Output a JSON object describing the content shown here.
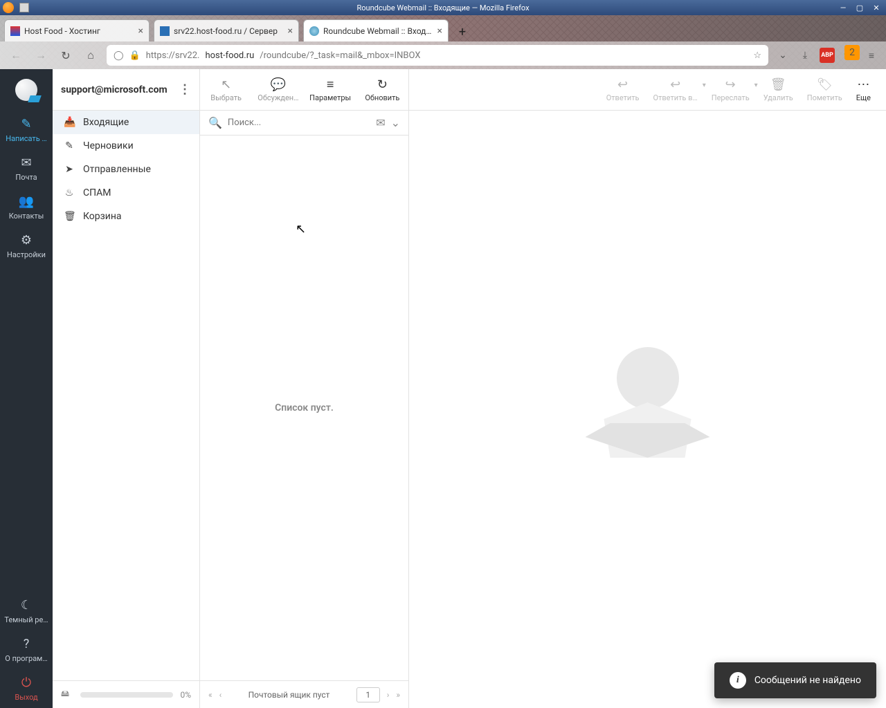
{
  "window": {
    "title": "Roundcube Webmail :: Входящие — Mozilla Firefox"
  },
  "browser": {
    "tabs": [
      {
        "label": "Host Food - Хостинг",
        "active": false
      },
      {
        "label": "srv22.host-food.ru / Сервер",
        "active": false
      },
      {
        "label": "Roundcube Webmail :: Вход…",
        "active": true
      }
    ],
    "url_prefix": "https://srv22.",
    "url_host": "host-food.ru",
    "url_path": "/roundcube/?_task=mail&_mbox=INBOX",
    "puzzle_badge": "2"
  },
  "sidebar": {
    "items": [
      {
        "icon": "✎",
        "label": "Написать …"
      },
      {
        "icon": "✉",
        "label": "Почта"
      },
      {
        "icon": "👥",
        "label": "Контакты"
      },
      {
        "icon": "⚙",
        "label": "Настройки"
      }
    ],
    "bottom": [
      {
        "icon": "☾",
        "label": "Темный ре…"
      },
      {
        "icon": "?",
        "label": "О програм…"
      },
      {
        "icon": "⏻",
        "label": "Выход"
      }
    ]
  },
  "account": {
    "email": "support@microsoft.com"
  },
  "folders": [
    {
      "icon": "inbox",
      "label": "Входящие",
      "active": true
    },
    {
      "icon": "pencil",
      "label": "Черновики"
    },
    {
      "icon": "send",
      "label": "Отправленные"
    },
    {
      "icon": "fire",
      "label": "СПАМ"
    },
    {
      "icon": "trash",
      "label": "Корзина"
    }
  ],
  "quota": {
    "percent": "0%"
  },
  "list_toolbar": [
    {
      "icon": "↖",
      "label": "Выбрать",
      "enabled": false
    },
    {
      "icon": "💬",
      "label": "Обсужден…",
      "enabled": false
    },
    {
      "icon": "≡",
      "label": "Параметры",
      "enabled": true
    },
    {
      "icon": "↻",
      "label": "Обновить",
      "enabled": true
    }
  ],
  "search": {
    "placeholder": "Поиск..."
  },
  "list_empty": "Список пуст.",
  "list_footer": {
    "status": "Почтовый ящик пуст",
    "page": "1"
  },
  "content_toolbar": [
    {
      "icon": "↩",
      "label": "Ответить",
      "caret": false
    },
    {
      "icon": "↩",
      "label": "Ответить в…",
      "caret": true
    },
    {
      "icon": "↪",
      "label": "Переслать",
      "caret": true
    },
    {
      "icon": "🗑",
      "label": "Удалить",
      "caret": false
    },
    {
      "icon": "🏷",
      "label": "Пометить",
      "caret": false
    },
    {
      "icon": "⋯",
      "label": "Еще",
      "caret": false,
      "enabled": true
    }
  ],
  "toast": {
    "text": "Сообщений не найдено"
  }
}
